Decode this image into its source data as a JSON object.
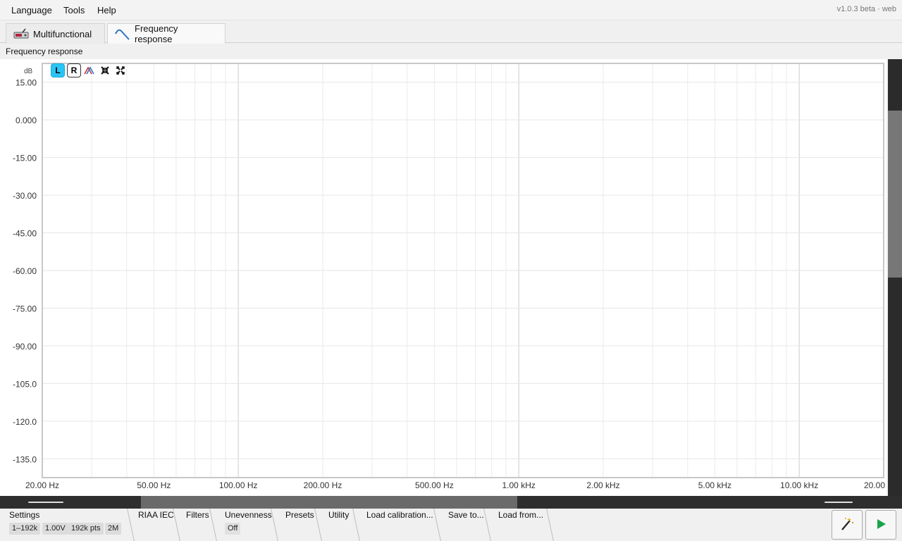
{
  "menu": {
    "items": [
      "Language",
      "Tools",
      "Help"
    ],
    "version": "v1.0.3 beta · web"
  },
  "tabs": [
    {
      "label": "Multifunctional",
      "icon": "multifunctional-device-icon",
      "active": false
    },
    {
      "label": "Frequency response",
      "icon": "frequency-curve-icon",
      "active": true
    }
  ],
  "section_title": "Frequency response",
  "toolbar": {
    "left_label": "L",
    "right_label": "R"
  },
  "colors": {
    "accent": "#29c5f6",
    "grid_major": "#cfcfcf",
    "grid_minor": "#ececec",
    "play": "#1aa34a"
  },
  "chart_data": {
    "type": "line",
    "title": "",
    "ylabel": "dB",
    "xlabel": "",
    "x_scale": "log",
    "xlim": [
      20,
      20000
    ],
    "ylim": [
      -142.5,
      22.5
    ],
    "y_ticks": [
      15,
      0,
      -15,
      -30,
      -45,
      -60,
      -75,
      -90,
      -105,
      -120,
      -135
    ],
    "y_tick_labels": [
      "15.00",
      "0.000",
      "-15.00",
      "-30.00",
      "-45.00",
      "-60.00",
      "-75.00",
      "-90.00",
      "-105.0",
      "-120.0",
      "-135.0"
    ],
    "x_ticks": [
      20,
      50,
      100,
      200,
      500,
      1000,
      2000,
      5000,
      10000,
      20000
    ],
    "x_tick_labels": [
      "20.00 Hz",
      "50.00 Hz",
      "100.00 Hz",
      "200.00 Hz",
      "500.00 Hz",
      "1.00 kHz",
      "2.00 kHz",
      "5.00 kHz",
      "10.00 kHz",
      "20.00"
    ],
    "series": [],
    "grid": true
  },
  "bottom": {
    "settings_label": "Settings",
    "chips": [
      "1–192k",
      "1.00V",
      "192k pts",
      "2M"
    ],
    "menus": [
      "RIAA IEC",
      "Filters",
      "Unevenness",
      "Presets",
      "Utility",
      "Load calibration...",
      "Save to...",
      "Load from..."
    ],
    "unevenness_value": "Off"
  }
}
